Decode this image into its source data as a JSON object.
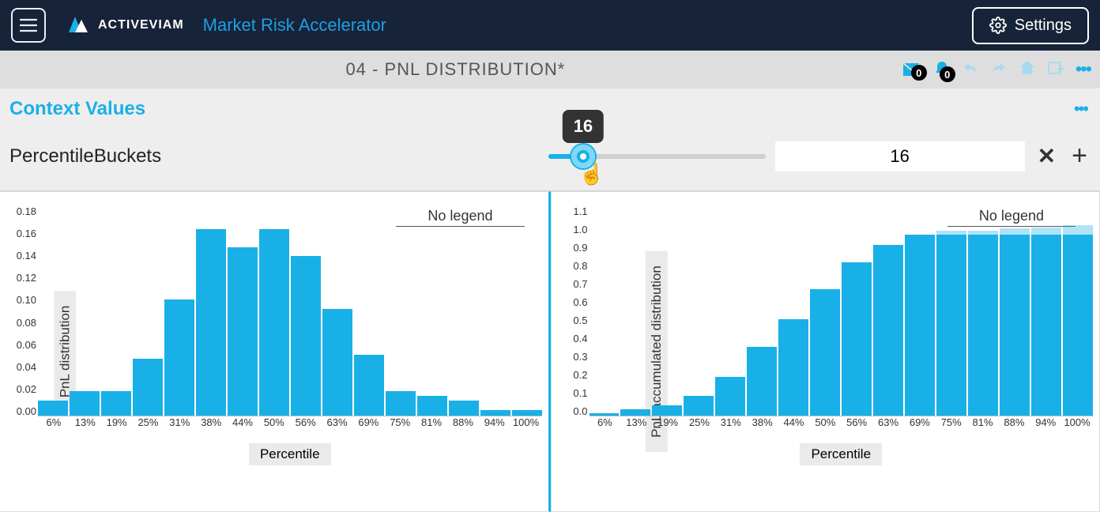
{
  "brand": {
    "logo_text": "ACTIVEVIAM",
    "app_title": "Market Risk Accelerator"
  },
  "settings_label": "Settings",
  "page_title": "04 - PNL DISTRIBUTION*",
  "toolbar": {
    "messages_count": "0",
    "alerts_count": "0"
  },
  "context": {
    "heading": "Context Values",
    "field_label": "PercentileBuckets",
    "slider_value": "16",
    "tooltip": "16"
  },
  "chart_data": [
    {
      "type": "bar",
      "title": "",
      "legend": "No legend",
      "ylabel": "PnL distribution",
      "xlabel": "Percentile",
      "ylim": [
        0,
        0.18
      ],
      "yticks": [
        "0.18",
        "0.16",
        "0.14",
        "0.12",
        "0.10",
        "0.08",
        "0.06",
        "0.04",
        "0.02",
        "0.00"
      ],
      "categories": [
        "6%",
        "13%",
        "19%",
        "25%",
        "31%",
        "38%",
        "44%",
        "50%",
        "56%",
        "63%",
        "69%",
        "75%",
        "81%",
        "88%",
        "94%",
        "100%"
      ],
      "values": [
        0.013,
        0.021,
        0.021,
        0.049,
        0.1,
        0.16,
        0.145,
        0.16,
        0.137,
        0.092,
        0.052,
        0.021,
        0.017,
        0.013,
        0.005,
        0.005
      ]
    },
    {
      "type": "bar",
      "title": "",
      "legend": "No legend",
      "ylabel": "PnL accumulated distribution",
      "xlabel": "Percentile",
      "ylim": [
        0,
        1.1
      ],
      "yticks": [
        "1.1",
        "1.0",
        "0.9",
        "0.8",
        "0.7",
        "0.6",
        "0.5",
        "0.4",
        "0.3",
        "0.2",
        "0.1",
        "0.0"
      ],
      "categories": [
        "6%",
        "13%",
        "19%",
        "25%",
        "31%",
        "38%",
        "44%",
        "50%",
        "56%",
        "63%",
        "69%",
        "75%",
        "81%",
        "88%",
        "94%",
        "100%"
      ],
      "values": [
        0.013,
        0.034,
        0.055,
        0.103,
        0.205,
        0.36,
        0.505,
        0.665,
        0.805,
        0.895,
        0.95,
        0.95,
        0.95,
        0.95,
        0.95,
        0.95
      ],
      "overlay_values": [
        null,
        null,
        null,
        null,
        null,
        null,
        null,
        null,
        null,
        null,
        null,
        0.97,
        0.97,
        0.985,
        0.99,
        1.0
      ]
    }
  ]
}
